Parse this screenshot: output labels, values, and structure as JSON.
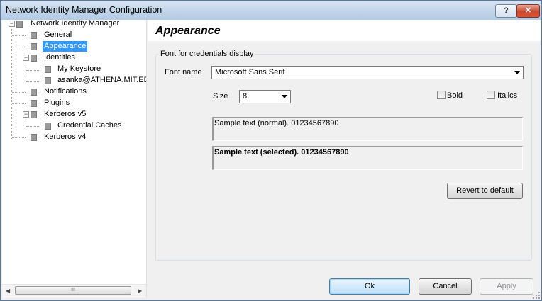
{
  "window": {
    "title": "Network Identity Manager Configuration",
    "help_label": "?",
    "close_label": "✕"
  },
  "tree": {
    "root": "Network Identity Manager",
    "items": {
      "general": "General",
      "appearance": "Appearance",
      "identities": "Identities",
      "my_keystore": "My Keystore",
      "identity_user": "asanka@ATHENA.MIT.EDU",
      "notifications": "Notifications",
      "plugins": "Plugins",
      "kerberos_v5": "Kerberos v5",
      "credential_caches": "Credential Caches",
      "kerberos_v4": "Kerberos v4"
    },
    "selected": "Appearance",
    "expander_collapse": "−",
    "scrollbar": {
      "left_arrow": "◀",
      "right_arrow": "▶",
      "thumb_grip": "III"
    }
  },
  "page": {
    "title": "Appearance",
    "group_label": "Font for credentials display",
    "font_name_label": "Font name",
    "font_name_value": "Microsoft Sans Serif",
    "size_label": "Size",
    "size_value": "8",
    "bold_label": "Bold",
    "bold_checked": false,
    "italics_label": "Italics",
    "italics_checked": false,
    "sample_normal": "Sample text (normal). 01234567890",
    "sample_selected": "Sample text (selected). 01234567890",
    "revert_label": "Revert to default"
  },
  "footer": {
    "ok_label": "Ok",
    "cancel_label": "Cancel",
    "apply_label": "Apply",
    "apply_enabled": false
  },
  "colors": {
    "selection": "#3399ff",
    "default_button_border": "#3c7fb1",
    "titlebar": "#c3d6ea"
  }
}
